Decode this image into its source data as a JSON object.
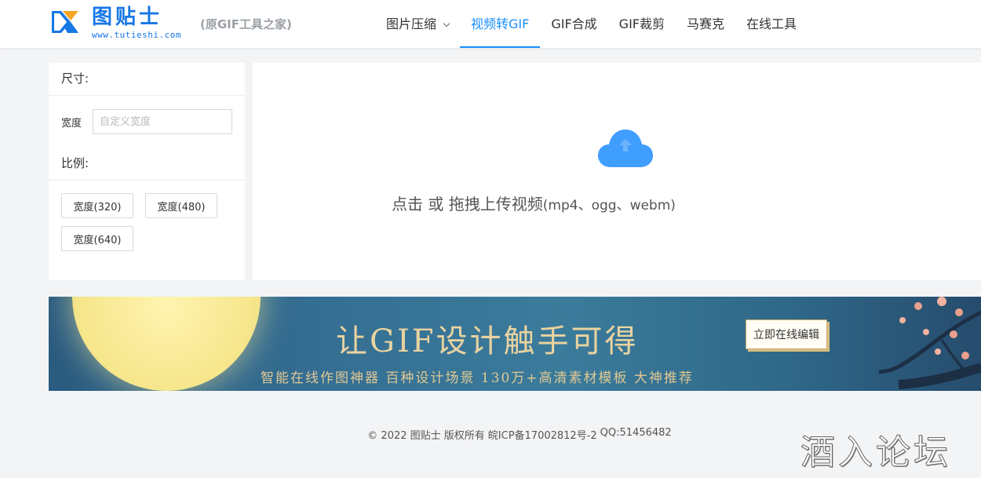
{
  "header": {
    "logo": {
      "name": "图贴士",
      "url": "www.tutieshi.com"
    },
    "tagline": "(原GIF工具之家)",
    "nav": [
      {
        "label": "图片压缩",
        "has_dropdown": true,
        "active": false
      },
      {
        "label": "视频转GIF",
        "has_dropdown": false,
        "active": true
      },
      {
        "label": "GIF合成",
        "has_dropdown": false,
        "active": false
      },
      {
        "label": "GIF裁剪",
        "has_dropdown": false,
        "active": false
      },
      {
        "label": "马赛克",
        "has_dropdown": false,
        "active": false
      },
      {
        "label": "在线工具",
        "has_dropdown": false,
        "active": false
      }
    ]
  },
  "settings": {
    "size_title": "尺寸:",
    "width_label": "宽度",
    "width_value": "",
    "width_placeholder": "自定义宽度",
    "ratio_title": "比例:",
    "ratio_options": [
      "宽度(320)",
      "宽度(480)",
      "宽度(640)"
    ]
  },
  "upload": {
    "icon": "cloud-upload-icon",
    "text_main": "点击 或 拖拽上传视频",
    "text_formats": "(mp4、ogg、webm)"
  },
  "banner": {
    "title": "让GIF设计触手可得",
    "subtitle": "智能在线作图神器  百种设计场景 130万+高清素材模板  大神推荐",
    "button": "立即在线编辑"
  },
  "footer": {
    "copyright": "© 2022 图贴士 版权所有",
    "icp": "皖ICP备17002812号-2",
    "qq": "QQ:51456482"
  },
  "watermark": "酒入论坛",
  "colors": {
    "accent": "#1890ff",
    "logo_blue": "#1677e5",
    "logo_orange": "#f5a623"
  }
}
